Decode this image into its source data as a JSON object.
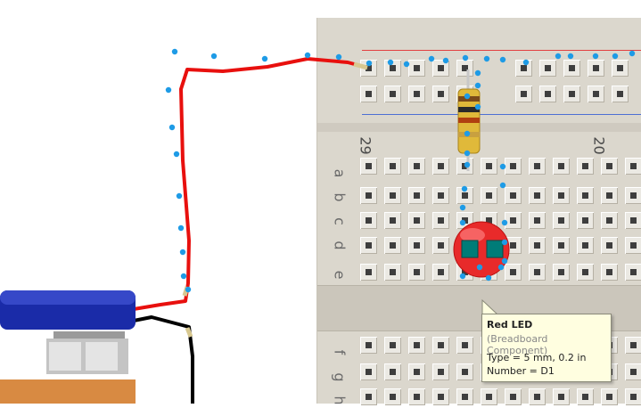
{
  "breadboard": {
    "column_labels": [
      "29",
      "20"
    ],
    "row_labels_top": [
      "a",
      "b",
      "c",
      "d",
      "e"
    ],
    "row_labels_bottom": [
      "f",
      "g",
      "h"
    ]
  },
  "tooltip": {
    "title": "Red LED",
    "subtitle": "(Breadboard Component)",
    "type_line": "Type = 5 mm, 0.2 in",
    "number_line": "Number = D1"
  },
  "colors": {
    "wire_red": "#e8100e",
    "wire_black": "#000000",
    "selection_dot": "#1e9be6",
    "led_red": "#e82a2a",
    "led_leads": "#007c78",
    "board": "#dbd7cd",
    "rail_red_line": "#e24040",
    "rail_blue_line": "#4d6fd4",
    "battery_blue": "#1a2ba8",
    "battery_base": "#d88a42"
  },
  "components": {
    "resistor": "resistor-icon",
    "led": "red-led-icon",
    "battery": "battery-holder-icon"
  }
}
